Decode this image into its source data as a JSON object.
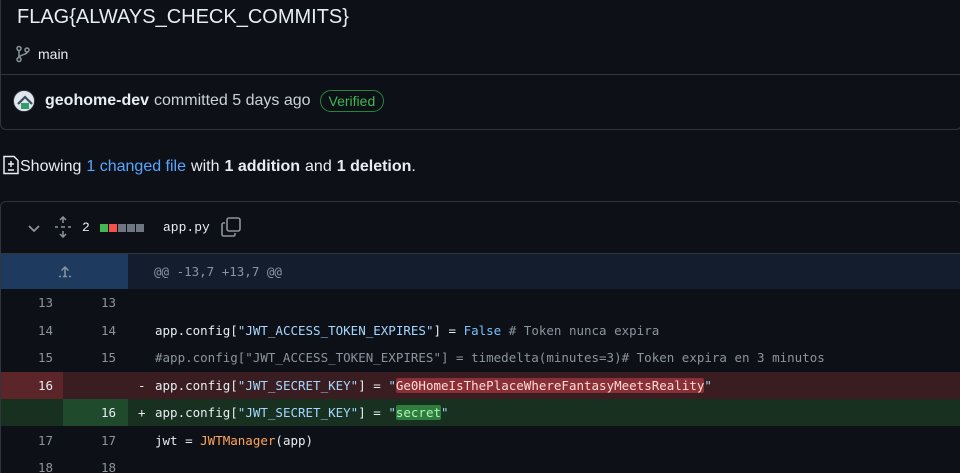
{
  "commit": {
    "title": "FLAG{ALWAYS_CHECK_COMMITS}",
    "branch": "main",
    "author": "geohome-dev",
    "committed_text": "committed 5 days ago",
    "verified_label": "Verified"
  },
  "summary": {
    "showing": "Showing",
    "changed_files": "1 changed file",
    "with": "with",
    "additions": "1 addition",
    "and": "and",
    "deletions": "1 deletion",
    "period": "."
  },
  "file": {
    "change_count": "2",
    "name": "app.py",
    "diffstat_colors": [
      "#3fb950",
      "#f85149",
      "#6e7681",
      "#6e7681",
      "#6e7681"
    ]
  },
  "diff": {
    "hunk_header": "@@ -13,7 +13,7 @@",
    "lines": [
      {
        "old": "13",
        "new": "13",
        "type": "context",
        "text": ""
      },
      {
        "old": "14",
        "new": "14",
        "type": "context",
        "text": "app.config[\"JWT_ACCESS_TOKEN_EXPIRES\"] = False # Token nunca expira"
      },
      {
        "old": "15",
        "new": "15",
        "type": "context",
        "text": "#app.config[\"JWT_ACCESS_TOKEN_EXPIRES\"] = timedelta(minutes=3)# Token expira en 3 minutos"
      },
      {
        "old": "16",
        "new": "",
        "type": "deletion",
        "marker": "-",
        "text": "app.config[\"JWT_SECRET_KEY\"] = \"Ge0HomeIsThePlaceWhereFantasyMeetsReality\""
      },
      {
        "old": "",
        "new": "16",
        "type": "addition",
        "marker": "+",
        "text": "app.config[\"JWT_SECRET_KEY\"] = \"secret\""
      },
      {
        "old": "17",
        "new": "17",
        "type": "context",
        "text": "jwt = JWTManager(app)"
      },
      {
        "old": "18",
        "new": "18",
        "type": "context",
        "text": ""
      }
    ]
  }
}
